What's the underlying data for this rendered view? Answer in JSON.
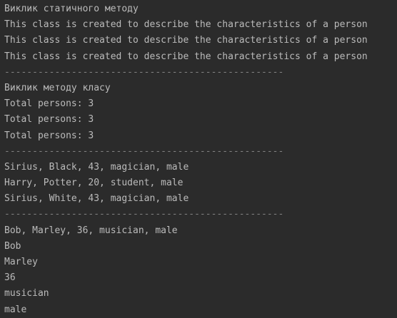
{
  "console": {
    "lines": [
      "Виклик статичного методу",
      "This class is created to describe the characteristics of a person",
      "This class is created to describe the characteristics of a person",
      "This class is created to describe the characteristics of a person",
      "--------------------------------------------------",
      "Виклик методу класу",
      "Total persons: 3",
      "Total persons: 3",
      "Total persons: 3",
      "--------------------------------------------------",
      "Sirius, Black, 43, magician, male",
      "Harry, Potter, 20, student, male",
      "Sirius, White, 43, magician, male",
      "--------------------------------------------------",
      "Bob, Marley, 36, musician, male",
      "Bob",
      "Marley",
      "36",
      "musician",
      "male"
    ]
  }
}
